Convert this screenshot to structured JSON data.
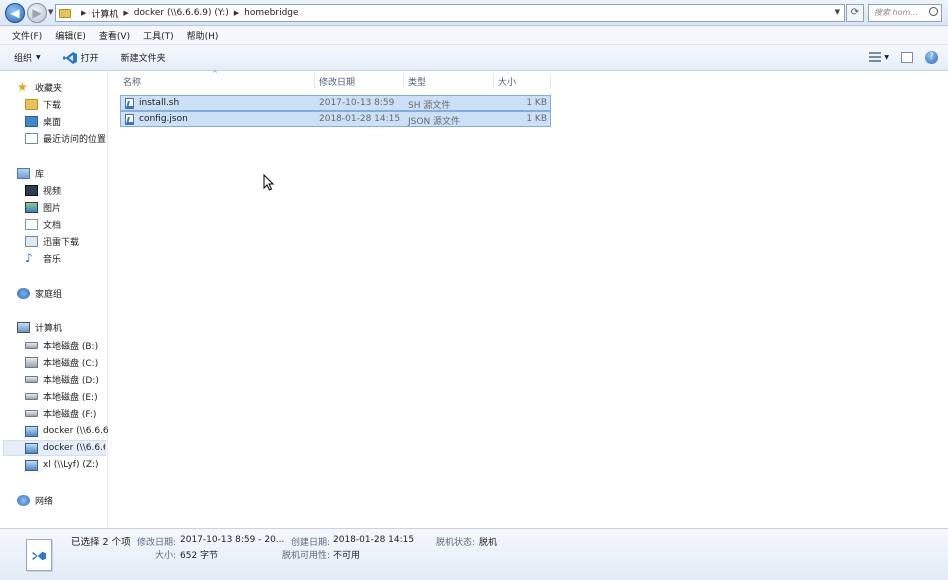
{
  "address": {
    "crumbs": [
      "计算机",
      "docker (\\\\6.6.6.9) (Y:)",
      "homebridge"
    ],
    "search_placeholder": "搜索 hom..."
  },
  "menu": [
    "文件(F)",
    "编辑(E)",
    "查看(V)",
    "工具(T)",
    "帮助(H)"
  ],
  "toolbar": {
    "organize": "组织",
    "open": "打开",
    "new_folder": "新建文件夹"
  },
  "nav": {
    "favorites": "收藏夹",
    "downloads": "下载",
    "desktop": "桌面",
    "recent": "最近访问的位置",
    "libraries": "库",
    "videos": "视频",
    "pictures": "图片",
    "documents": "文档",
    "xunlei": "迅雷下载",
    "music": "音乐",
    "homegroup": "家庭组",
    "computer": "计算机",
    "drives": [
      "本地磁盘 (B:)",
      "本地磁盘 (C:)",
      "本地磁盘 (D:)",
      "本地磁盘 (E:)",
      "本地磁盘 (F:)"
    ],
    "net_drives": [
      "docker (\\\\6.6.6.",
      "docker (\\\\6.6.6.",
      "xl (\\\\Lyf) (Z:)"
    ],
    "network": "网络"
  },
  "columns": {
    "name": "名称",
    "date": "修改日期",
    "type": "类型",
    "size": "大小"
  },
  "files": [
    {
      "name": "install.sh",
      "date": "2017-10-13 8:59",
      "type": "SH 源文件",
      "size": "1 KB"
    },
    {
      "name": "config.json",
      "date": "2018-01-28 14:15",
      "type": "JSON 源文件",
      "size": "1 KB"
    }
  ],
  "details": {
    "selected": "已选择 2 个项",
    "modified_label": "修改日期:",
    "modified_value": "2017-10-13 8:59 - 20...",
    "created_label": "创建日期:",
    "created_value": "2018-01-28 14:15",
    "offline_status_label": "脱机状态:",
    "offline_status_value": "脱机",
    "size_label": "大小:",
    "size_value": "652 字节",
    "offline_avail_label": "脱机可用性:",
    "offline_avail_value": "不可用"
  }
}
